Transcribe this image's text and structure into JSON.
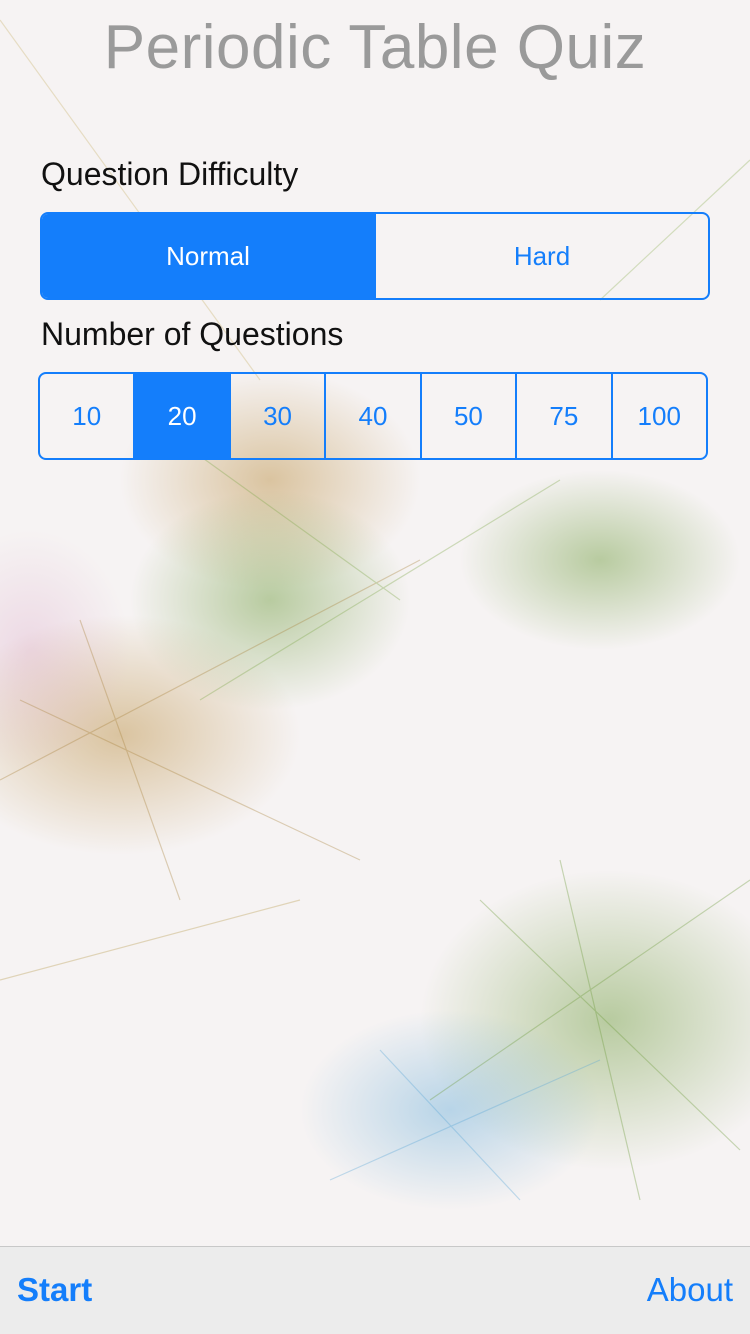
{
  "app": {
    "title": "Periodic Table Quiz"
  },
  "difficulty": {
    "label": "Question Difficulty",
    "options": [
      "Normal",
      "Hard"
    ],
    "selected": "Normal"
  },
  "question_count": {
    "label": "Number of Questions",
    "options": [
      "10",
      "20",
      "30",
      "40",
      "50",
      "75",
      "100"
    ],
    "selected": "20"
  },
  "toolbar": {
    "start_label": "Start",
    "about_label": "About"
  },
  "colors": {
    "accent": "#147efb",
    "title": "#9a9a9a",
    "toolbar_bg": "#ececec"
  }
}
